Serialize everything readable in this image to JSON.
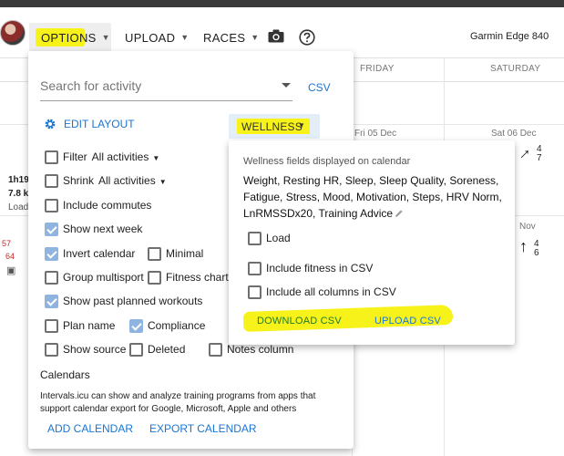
{
  "appbar": {
    "options_label": "OPTIONS",
    "upload_label": "UPLOAD",
    "races_label": "RACES",
    "device_name": "Garmin Edge 840"
  },
  "calendar": {
    "days": [
      "FRIDAY",
      "SATURDAY"
    ],
    "dates": [
      "Fri 05 Dec",
      "Sat 06 Dec",
      "Nov"
    ],
    "fraction_top": {
      "num": "4",
      "den": "7"
    },
    "fraction_bottom": {
      "num": "4",
      "den": "6"
    },
    "left_stats": [
      "1h19",
      "7.8 k",
      "Load",
      "57",
      "64"
    ]
  },
  "options": {
    "search_placeholder": "Search for activity",
    "csv_label": "CSV",
    "edit_layout_label": "EDIT LAYOUT",
    "wellness_label": "WELLNESS",
    "filter_label": "Filter",
    "filter_value": "All activities",
    "shrink_label": "Shrink",
    "shrink_value": "All activities",
    "checkboxes": {
      "include_commutes": {
        "label": "Include commutes",
        "checked": false
      },
      "show_next_week": {
        "label": "Show next week",
        "checked": true
      },
      "invert_calendar": {
        "label": "Invert calendar",
        "checked": true
      },
      "minimal": {
        "label": "Minimal",
        "checked": false
      },
      "group_multisport": {
        "label": "Group multisport",
        "checked": false
      },
      "fitness_chart": {
        "label": "Fitness chart",
        "checked": false
      },
      "show_past_planned": {
        "label": "Show past planned workouts",
        "checked": true
      },
      "plan_name": {
        "label": "Plan name",
        "checked": false
      },
      "compliance": {
        "label": "Compliance",
        "checked": true
      },
      "show_source": {
        "label": "Show source",
        "checked": false
      },
      "deleted": {
        "label": "Deleted",
        "checked": false
      },
      "notes_column": {
        "label": "Notes column",
        "checked": false
      }
    },
    "calendars_title": "Calendars",
    "calendars_desc": "Intervals.icu can show and analyze training programs from apps that support calendar export for Google, Microsoft, Apple and others",
    "add_calendar": "ADD CALENDAR",
    "export_calendar": "EXPORT CALENDAR"
  },
  "wellness": {
    "title": "Wellness fields displayed on calendar",
    "fields": "Weight, Resting HR, Sleep, Sleep Quality, Soreness, Fatigue, Stress, Mood, Motivation, Steps, HRV Norm, LnRMSSDx20, Training Advice",
    "load_label": "Load",
    "include_fitness_label": "Include fitness in CSV",
    "include_all_label": "Include all columns in CSV",
    "download_label": "DOWNLOAD CSV",
    "upload_label": "UPLOAD CSV"
  },
  "colors": {
    "highlight": "#f7f31a",
    "link": "#1976d2",
    "download": "#1e7a2e",
    "checked": "#90b4e0"
  }
}
